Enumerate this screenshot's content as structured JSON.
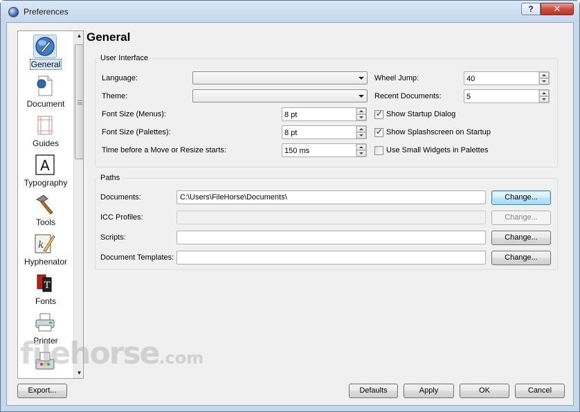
{
  "window": {
    "title": "Preferences",
    "help_glyph": "?",
    "close_glyph": "✕"
  },
  "sidebar": {
    "items": [
      {
        "label": "General",
        "icon": "globe-pen-icon"
      },
      {
        "label": "Document",
        "icon": "document-icon"
      },
      {
        "label": "Guides",
        "icon": "guides-icon"
      },
      {
        "label": "Typography",
        "icon": "letter-a-icon"
      },
      {
        "label": "Tools",
        "icon": "hammer-icon"
      },
      {
        "label": "Hyphenator",
        "icon": "quill-paper-icon"
      },
      {
        "label": "Fonts",
        "icon": "fonts-icon"
      },
      {
        "label": "Printer",
        "icon": "printer-icon"
      },
      {
        "label": "",
        "icon": "preflight-icon"
      }
    ],
    "selected": "General"
  },
  "page": {
    "title": "General",
    "user_interface": {
      "group_title": "User Interface",
      "language_label": "Language:",
      "language_value": "",
      "theme_label": "Theme:",
      "theme_value": "",
      "font_menus_label": "Font Size (Menus):",
      "font_menus_value": "8 pt",
      "font_palettes_label": "Font Size (Palettes):",
      "font_palettes_value": "8 pt",
      "move_resize_label": "Time before a Move or Resize starts:",
      "move_resize_value": "150 ms",
      "wheel_jump_label": "Wheel Jump:",
      "wheel_jump_value": "40",
      "recent_docs_label": "Recent Documents:",
      "recent_docs_value": "5",
      "show_startup_dialog": "Show Startup Dialog",
      "show_splash": "Show Splashscreen on Startup",
      "small_widgets": "Use Small Widgets in Palettes"
    },
    "paths": {
      "group_title": "Paths",
      "documents_label": "Documents:",
      "documents_value": "C:\\Users\\FileHorse\\Documents\\",
      "icc_label": "ICC Profiles:",
      "icc_value": "",
      "scripts_label": "Scripts:",
      "scripts_value": "",
      "templates_label": "Document Templates:",
      "templates_value": "",
      "change_label": "Change..."
    }
  },
  "footer": {
    "export_label": "Export...",
    "defaults_label": "Defaults",
    "apply_label": "Apply",
    "ok_label": "OK",
    "cancel_label": "Cancel"
  },
  "watermark": {
    "main": "filehorse",
    "suffix": ".com"
  }
}
